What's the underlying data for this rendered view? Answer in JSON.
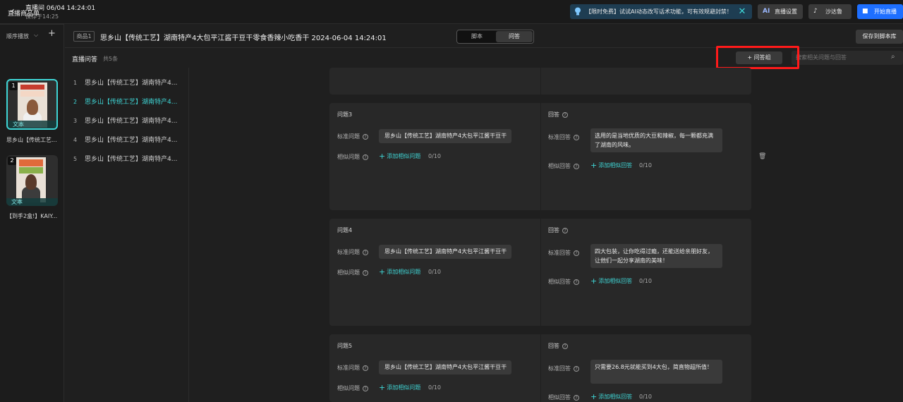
{
  "topbar": {
    "back_icon": "chevron-left-icon",
    "title": "直播间 06/04 14:24:01",
    "saved": "保存于14:25",
    "promo_text": "【限时免费】试试AI动态改写话术功能，可有效规避封禁！",
    "buttons": [
      {
        "icon": "ai",
        "label": "直播设置"
      },
      {
        "icon": "tiktok-icon",
        "label": "沙达鲁"
      },
      {
        "icon": "camera-icon",
        "label": "开始直播"
      }
    ],
    "accent_color": "#3fd6d6",
    "primary_color": "#1e6fff"
  },
  "left": {
    "heading": "直播商品单",
    "order_label": "顺序播放",
    "cards": [
      {
        "num": "1",
        "tag": "文本",
        "caption": "思乡山【传统工艺..."
      },
      {
        "num": "2",
        "tag": "文本",
        "caption": "【到手2盒!】KAIY..."
      }
    ]
  },
  "header": {
    "product_tag": "商品1",
    "product_title": "思乡山【传统工艺】湖南特产4大包平江酱干豆干零食香辣小吃香干 2024-06-04 14:24:01",
    "tabs": [
      "脚本",
      "问答"
    ],
    "save_label": "保存到脚本库"
  },
  "qa": {
    "label": "直播问答",
    "count": "共5条",
    "add_group": "+ 问答组",
    "search_placeholder": "搜索相关问题与回答",
    "list": [
      "思乡山【传统工艺】湖南特产4...",
      "思乡山【传统工艺】湖南特产4...",
      "思乡山【传统工艺】湖南特产4...",
      "思乡山【传统工艺】湖南特产4...",
      "思乡山【传统工艺】湖南特产4..."
    ]
  },
  "panels": [
    {
      "q_title": "问题3",
      "a_title": "回答",
      "std_q_label": "标准问题",
      "sim_q_label": "相似问题",
      "std_a_label": "标准回答",
      "sim_a_label": "相似回答",
      "question": "思乡山【传统工艺】湖南特产4大包平江酱干豆干",
      "answer": "选用的是当地优质的大豆和辣椒，每一颗都充满了湖南的风味。",
      "add_q": "添加相似问题",
      "add_a": "添加相似回答",
      "q_count": "0/10",
      "a_count": "0/10"
    },
    {
      "q_title": "问题4",
      "a_title": "回答",
      "std_q_label": "标准问题",
      "sim_q_label": "相似问题",
      "std_a_label": "标准回答",
      "sim_a_label": "相似回答",
      "question": "思乡山【传统工艺】湖南特产4大包平江酱干豆干",
      "answer": "四大包装，让你吃得过瘾，还能送给亲朋好友，让他们一起分享湖南的美味！",
      "add_q": "添加相似问题",
      "add_a": "添加相似回答",
      "q_count": "0/10",
      "a_count": "0/10"
    },
    {
      "q_title": "问题5",
      "a_title": "回答",
      "std_q_label": "标准问题",
      "sim_q_label": "相似问题",
      "std_a_label": "标准回答",
      "sim_a_label": "相似回答",
      "question": "思乡山【传统工艺】湖南特产4大包平江酱干豆干",
      "answer": "只需要26.8元就能买到4大包，简直物超所值！",
      "add_q": "添加相似问题",
      "add_a": "添加相似回答",
      "q_count": "0/10",
      "a_count": "0/10"
    }
  ]
}
